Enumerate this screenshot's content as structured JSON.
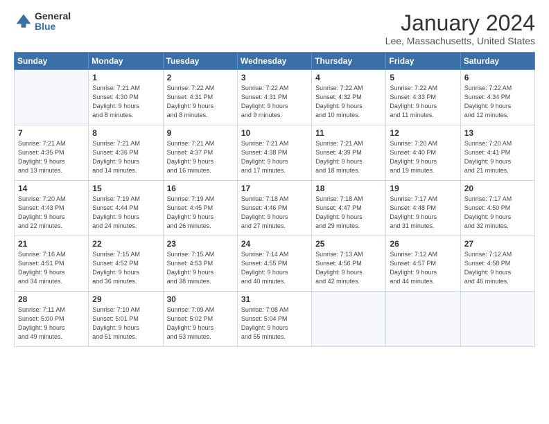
{
  "logo": {
    "general": "General",
    "blue": "Blue"
  },
  "header": {
    "title": "January 2024",
    "subtitle": "Lee, Massachusetts, United States"
  },
  "weekdays": [
    "Sunday",
    "Monday",
    "Tuesday",
    "Wednesday",
    "Thursday",
    "Friday",
    "Saturday"
  ],
  "weeks": [
    [
      {
        "day": "",
        "detail": ""
      },
      {
        "day": "1",
        "detail": "Sunrise: 7:21 AM\nSunset: 4:30 PM\nDaylight: 9 hours\nand 8 minutes."
      },
      {
        "day": "2",
        "detail": "Sunrise: 7:22 AM\nSunset: 4:31 PM\nDaylight: 9 hours\nand 8 minutes."
      },
      {
        "day": "3",
        "detail": "Sunrise: 7:22 AM\nSunset: 4:31 PM\nDaylight: 9 hours\nand 9 minutes."
      },
      {
        "day": "4",
        "detail": "Sunrise: 7:22 AM\nSunset: 4:32 PM\nDaylight: 9 hours\nand 10 minutes."
      },
      {
        "day": "5",
        "detail": "Sunrise: 7:22 AM\nSunset: 4:33 PM\nDaylight: 9 hours\nand 11 minutes."
      },
      {
        "day": "6",
        "detail": "Sunrise: 7:22 AM\nSunset: 4:34 PM\nDaylight: 9 hours\nand 12 minutes."
      }
    ],
    [
      {
        "day": "7",
        "detail": ""
      },
      {
        "day": "8",
        "detail": "Sunrise: 7:21 AM\nSunset: 4:36 PM\nDaylight: 9 hours\nand 14 minutes."
      },
      {
        "day": "9",
        "detail": "Sunrise: 7:21 AM\nSunset: 4:37 PM\nDaylight: 9 hours\nand 16 minutes."
      },
      {
        "day": "10",
        "detail": "Sunrise: 7:21 AM\nSunset: 4:38 PM\nDaylight: 9 hours\nand 17 minutes."
      },
      {
        "day": "11",
        "detail": "Sunrise: 7:21 AM\nSunset: 4:39 PM\nDaylight: 9 hours\nand 18 minutes."
      },
      {
        "day": "12",
        "detail": "Sunrise: 7:20 AM\nSunset: 4:40 PM\nDaylight: 9 hours\nand 19 minutes."
      },
      {
        "day": "13",
        "detail": "Sunrise: 7:20 AM\nSunset: 4:41 PM\nDaylight: 9 hours\nand 21 minutes."
      }
    ],
    [
      {
        "day": "14",
        "detail": "Sunrise: 7:20 AM\nSunset: 4:43 PM\nDaylight: 9 hours\nand 22 minutes."
      },
      {
        "day": "15",
        "detail": "Sunrise: 7:19 AM\nSunset: 4:44 PM\nDaylight: 9 hours\nand 24 minutes."
      },
      {
        "day": "16",
        "detail": "Sunrise: 7:19 AM\nSunset: 4:45 PM\nDaylight: 9 hours\nand 26 minutes."
      },
      {
        "day": "17",
        "detail": "Sunrise: 7:18 AM\nSunset: 4:46 PM\nDaylight: 9 hours\nand 27 minutes."
      },
      {
        "day": "18",
        "detail": "Sunrise: 7:18 AM\nSunset: 4:47 PM\nDaylight: 9 hours\nand 29 minutes."
      },
      {
        "day": "19",
        "detail": "Sunrise: 7:17 AM\nSunset: 4:48 PM\nDaylight: 9 hours\nand 31 minutes."
      },
      {
        "day": "20",
        "detail": "Sunrise: 7:17 AM\nSunset: 4:50 PM\nDaylight: 9 hours\nand 32 minutes."
      }
    ],
    [
      {
        "day": "21",
        "detail": "Sunrise: 7:16 AM\nSunset: 4:51 PM\nDaylight: 9 hours\nand 34 minutes."
      },
      {
        "day": "22",
        "detail": "Sunrise: 7:15 AM\nSunset: 4:52 PM\nDaylight: 9 hours\nand 36 minutes."
      },
      {
        "day": "23",
        "detail": "Sunrise: 7:15 AM\nSunset: 4:53 PM\nDaylight: 9 hours\nand 38 minutes."
      },
      {
        "day": "24",
        "detail": "Sunrise: 7:14 AM\nSunset: 4:55 PM\nDaylight: 9 hours\nand 40 minutes."
      },
      {
        "day": "25",
        "detail": "Sunrise: 7:13 AM\nSunset: 4:56 PM\nDaylight: 9 hours\nand 42 minutes."
      },
      {
        "day": "26",
        "detail": "Sunrise: 7:12 AM\nSunset: 4:57 PM\nDaylight: 9 hours\nand 44 minutes."
      },
      {
        "day": "27",
        "detail": "Sunrise: 7:12 AM\nSunset: 4:58 PM\nDaylight: 9 hours\nand 46 minutes."
      }
    ],
    [
      {
        "day": "28",
        "detail": "Sunrise: 7:11 AM\nSunset: 5:00 PM\nDaylight: 9 hours\nand 49 minutes."
      },
      {
        "day": "29",
        "detail": "Sunrise: 7:10 AM\nSunset: 5:01 PM\nDaylight: 9 hours\nand 51 minutes."
      },
      {
        "day": "30",
        "detail": "Sunrise: 7:09 AM\nSunset: 5:02 PM\nDaylight: 9 hours\nand 53 minutes."
      },
      {
        "day": "31",
        "detail": "Sunrise: 7:08 AM\nSunset: 5:04 PM\nDaylight: 9 hours\nand 55 minutes."
      },
      {
        "day": "",
        "detail": ""
      },
      {
        "day": "",
        "detail": ""
      },
      {
        "day": "",
        "detail": ""
      }
    ]
  ],
  "week1_sunday_detail": "Sunrise: 7:21 AM\nSunset: 4:35 PM\nDaylight: 9 hours\nand 13 minutes."
}
